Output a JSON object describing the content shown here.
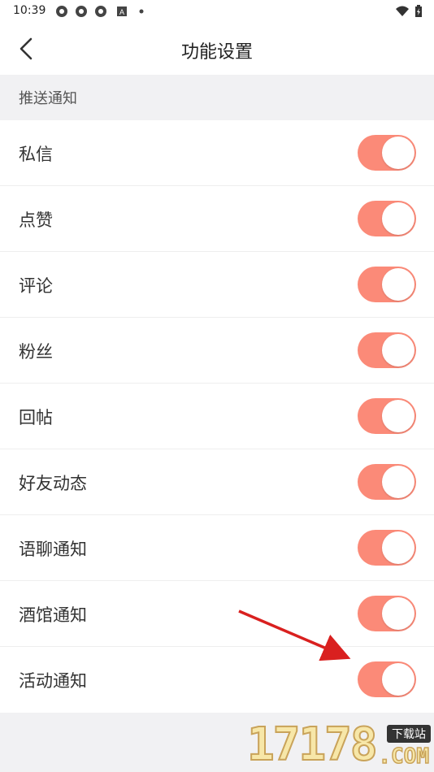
{
  "status_bar": {
    "time": "10:39",
    "left_icons": [
      "gear-icon",
      "gear-icon",
      "gear-icon",
      "a-icon",
      "dot-icon"
    ],
    "right_icons": [
      "wifi-icon",
      "battery-icon"
    ]
  },
  "nav": {
    "title": "功能设置",
    "back_icon": "chevron-left-icon"
  },
  "section": {
    "title": "推送通知"
  },
  "settings": [
    {
      "label": "私信",
      "enabled": true
    },
    {
      "label": "点赞",
      "enabled": true
    },
    {
      "label": "评论",
      "enabled": true
    },
    {
      "label": "粉丝",
      "enabled": true
    },
    {
      "label": "回帖",
      "enabled": true
    },
    {
      "label": "好友动态",
      "enabled": true
    },
    {
      "label": "语聊通知",
      "enabled": true
    },
    {
      "label": "酒馆通知",
      "enabled": true
    },
    {
      "label": "活动通知",
      "enabled": true
    }
  ],
  "colors": {
    "toggle_on": "#fb8a78",
    "section_bg": "#f1f1f3",
    "annotation_arrow": "#d9201f"
  },
  "watermark": {
    "number": "17178",
    "tag": "下载站",
    "domain": ".COM"
  }
}
